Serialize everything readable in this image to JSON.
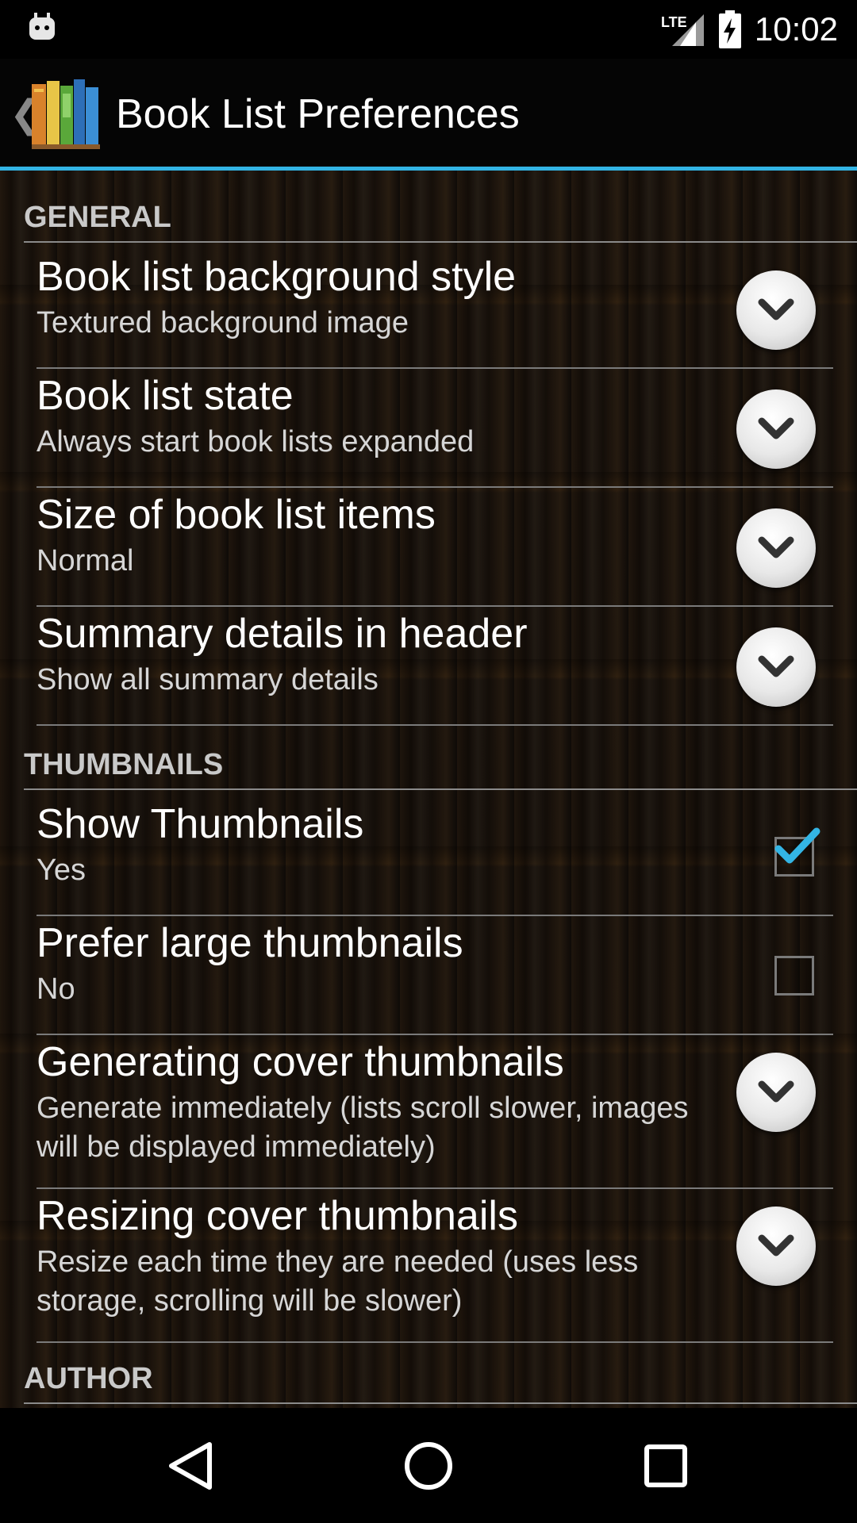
{
  "status_bar": {
    "network": "LTE",
    "time": "10:02"
  },
  "action_bar": {
    "title": "Book List Preferences"
  },
  "sections": [
    {
      "header": "GENERAL",
      "items": [
        {
          "title": "Book list background style",
          "summary": "Textured background image",
          "control": "dropdown"
        },
        {
          "title": "Book list state",
          "summary": "Always start book lists expanded",
          "control": "dropdown"
        },
        {
          "title": "Size of book list items",
          "summary": "Normal",
          "control": "dropdown"
        },
        {
          "title": "Summary details in header",
          "summary": "Show all summary details",
          "control": "dropdown"
        }
      ]
    },
    {
      "header": "THUMBNAILS",
      "items": [
        {
          "title": "Show Thumbnails",
          "summary": "Yes",
          "control": "checkbox",
          "checked": true
        },
        {
          "title": "Prefer large thumbnails",
          "summary": "No",
          "control": "checkbox",
          "checked": false
        },
        {
          "title": "Generating cover thumbnails",
          "summary": "Generate immediately (lists scroll slower, images will be displayed immediately)",
          "control": "dropdown"
        },
        {
          "title": "Resizing cover thumbnails",
          "summary": "Resize each time they are needed (uses less storage, scrolling will be slower)",
          "control": "dropdown"
        }
      ]
    },
    {
      "header": "AUTHOR",
      "items": []
    }
  ],
  "icons": {
    "status_left": "android-notification-icon",
    "signal": "lte-signal-icon",
    "battery": "battery-charging-icon",
    "back": "back-chevron-icon",
    "app": "bookshelf-app-icon",
    "dropdown": "chevron-down-icon",
    "nav_back": "nav-back-icon",
    "nav_home": "nav-home-icon",
    "nav_recents": "nav-recents-icon"
  },
  "colors": {
    "accent": "#33b5e5",
    "checkmark": "#33b5e5",
    "section_header": "#c9c9c9",
    "divider": "#7a7a7a"
  }
}
